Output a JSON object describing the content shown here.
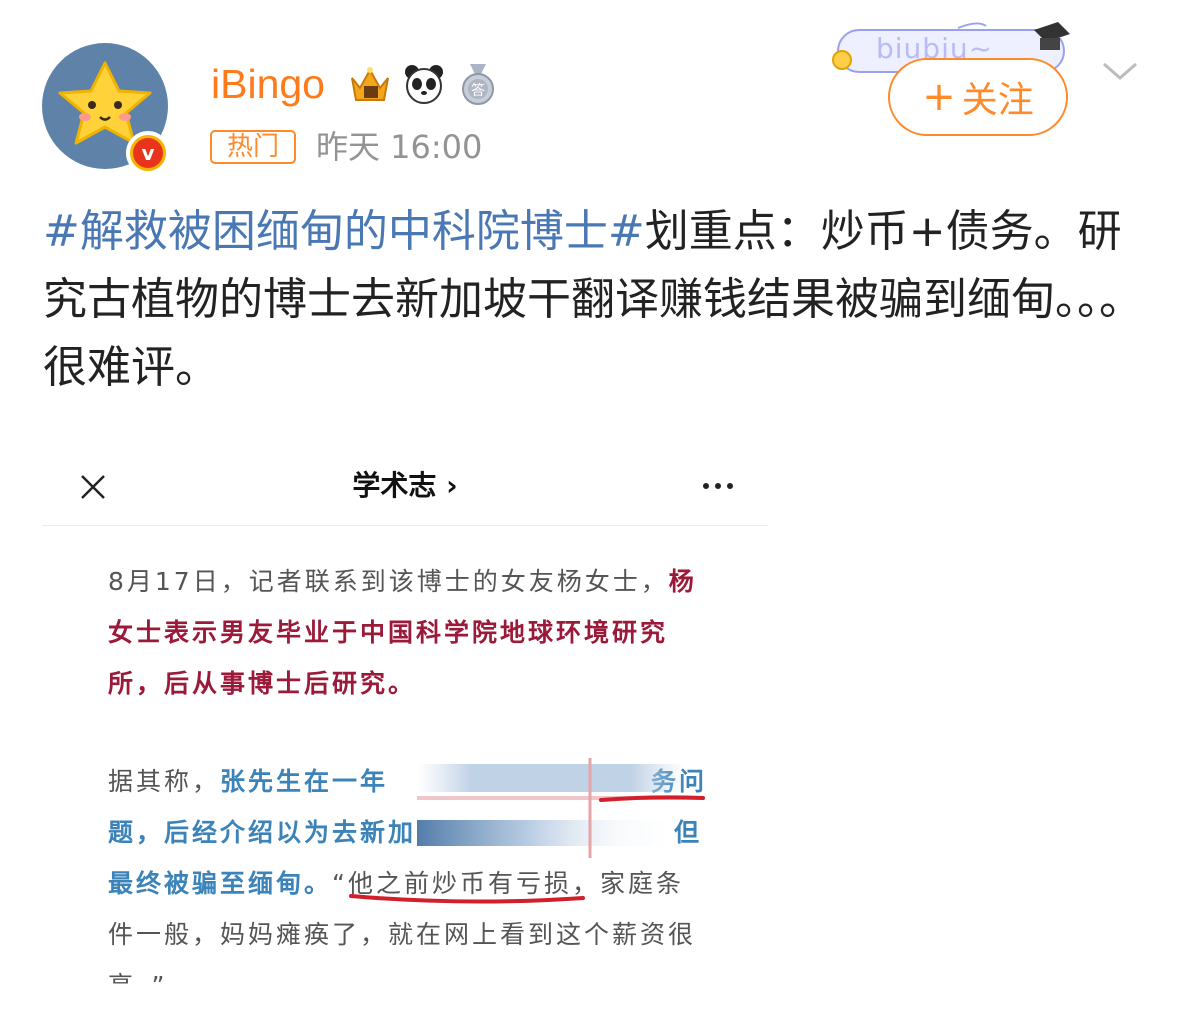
{
  "user": {
    "name": "iBingo",
    "badges": [
      "crown-badge-icon",
      "panda-badge-icon",
      "answer-medal-icon"
    ],
    "hot_tag": "热门",
    "timestamp": "昨天 16:00",
    "verified_mark": "v"
  },
  "follow_card": {
    "deco_text": "biubiu~",
    "follow_plus": "+",
    "follow_label": "关注"
  },
  "post": {
    "topic": "#解救被困缅甸的中科院博士#",
    "body": "划重点：炒币+债务。研究古植物的博士去新加坡干翻译赚钱结果被骗到缅甸。。。很难评。"
  },
  "embedded": {
    "title": "学术志",
    "title_chevron": "›",
    "p1_plain": "8月17日，记者联系到该博士的女友杨女士，",
    "p1_red": "杨女士表示男友毕业于中国科学院地球环境研究所，后从事博士后研究。",
    "p2_plain": "据其称，",
    "p2_blue_a": "张先生在一年",
    "p2_blue_a_end": "务问",
    "p2_blue_b": "题，后经介绍以为去新加",
    "p2_blue_b_end": "但",
    "p2_blue_c": "最终被骗至缅甸。",
    "p2_quote": "“他之前炒币有亏损，家庭条件一般，妈妈瘫痪了，就在网上看到这个薪资很高。”",
    "underline_color": "#d21f2a"
  },
  "colors": {
    "accent": "#ff8a2a",
    "topic": "#4a78b5",
    "timestamp": "#939393",
    "red_text": "#9b1a3a",
    "blue_text": "#3b83b8"
  }
}
